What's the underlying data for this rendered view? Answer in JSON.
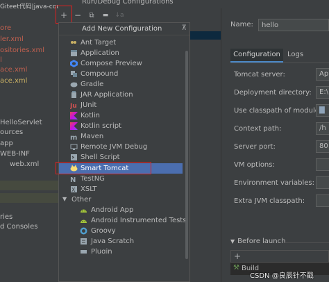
{
  "window": {
    "title": "Run/Debug Configurations",
    "watermark_top": "Giteet代码|java-cou",
    "watermark_bottom": "CSDN @良辰针不戳"
  },
  "left_pane": {
    "items": [
      {
        "label": "ore",
        "color": "#c0604f"
      },
      {
        "label": "ler.xml",
        "color": "#c0604f"
      },
      {
        "label": "ositories.xml",
        "color": "#c0604f"
      },
      {
        "label": "l",
        "color": "#c0604f"
      },
      {
        "label": "ace.xml",
        "color": "#c0604f"
      },
      {
        "label": "ace.xml",
        "color": "#c9b064"
      },
      {
        "label": "HelloServlet",
        "color": "#bbbbbb"
      },
      {
        "label": "ources",
        "color": "#bbbbbb"
      },
      {
        "label": "app",
        "color": "#bbbbbb"
      },
      {
        "label": "WEB-INF",
        "color": "#bbbbbb"
      },
      {
        "label": "web.xml",
        "color": "#bbbbbb"
      },
      {
        "label": "ries",
        "color": "#bbbbbb"
      },
      {
        "label": "d Consoles",
        "color": "#bbbbbb"
      }
    ]
  },
  "toolbar": {
    "add_label": "+",
    "remove_label": "−",
    "copy_label": "⧉",
    "folder_label": "▬",
    "sort_label": "↓a"
  },
  "popup": {
    "header": "Add New Configuration",
    "pin_label": "⊼",
    "items": [
      {
        "label": "Ant Target",
        "icon": "ant-icon"
      },
      {
        "label": "Application",
        "icon": "application-icon"
      },
      {
        "label": "Compose Preview",
        "icon": "compose-icon"
      },
      {
        "label": "Compound",
        "icon": "compound-icon"
      },
      {
        "label": "Gradle",
        "icon": "gradle-icon"
      },
      {
        "label": "JAR Application",
        "icon": "jar-icon"
      },
      {
        "label": "JUnit",
        "icon": "junit-icon"
      },
      {
        "label": "Kotlin",
        "icon": "kotlin-icon"
      },
      {
        "label": "Kotlin script",
        "icon": "kotlin-icon"
      },
      {
        "label": "Maven",
        "icon": "maven-icon"
      },
      {
        "label": "Remote JVM Debug",
        "icon": "remote-debug-icon"
      },
      {
        "label": "Shell Script",
        "icon": "shell-icon"
      },
      {
        "label": "Smart Tomcat",
        "icon": "tomcat-icon",
        "selected": true
      },
      {
        "label": "TestNG",
        "icon": "testng-icon"
      },
      {
        "label": "XSLT",
        "icon": "xslt-icon"
      }
    ],
    "other_label": "Other",
    "other_items": [
      {
        "label": "Android App",
        "icon": "android-icon"
      },
      {
        "label": "Android Instrumented Tests",
        "icon": "android-icon"
      },
      {
        "label": "Groovy",
        "icon": "groovy-icon"
      },
      {
        "label": "Java Scratch",
        "icon": "java-scratch-icon"
      },
      {
        "label": "Plugin",
        "icon": "plugin-icon"
      }
    ]
  },
  "form": {
    "name_label": "Name:",
    "name_value": "hello",
    "tabs": [
      "Configuration",
      "Logs"
    ],
    "fields": [
      {
        "label": "Tomcat server:",
        "value": "Ap"
      },
      {
        "label": "Deployment directory:",
        "value": "E:\\"
      },
      {
        "label": "Use classpath of module:",
        "value": "▇"
      },
      {
        "label": "Context path:",
        "value": "/h"
      },
      {
        "label": "Server port:",
        "value": "80"
      },
      {
        "label": "VM options:",
        "value": ""
      },
      {
        "label": "Environment variables:",
        "value": ""
      },
      {
        "label": "Extra JVM classpath:",
        "value": ""
      }
    ],
    "before_launch_label": "Before launch",
    "add_task_label": "+",
    "build_label": "Build"
  }
}
